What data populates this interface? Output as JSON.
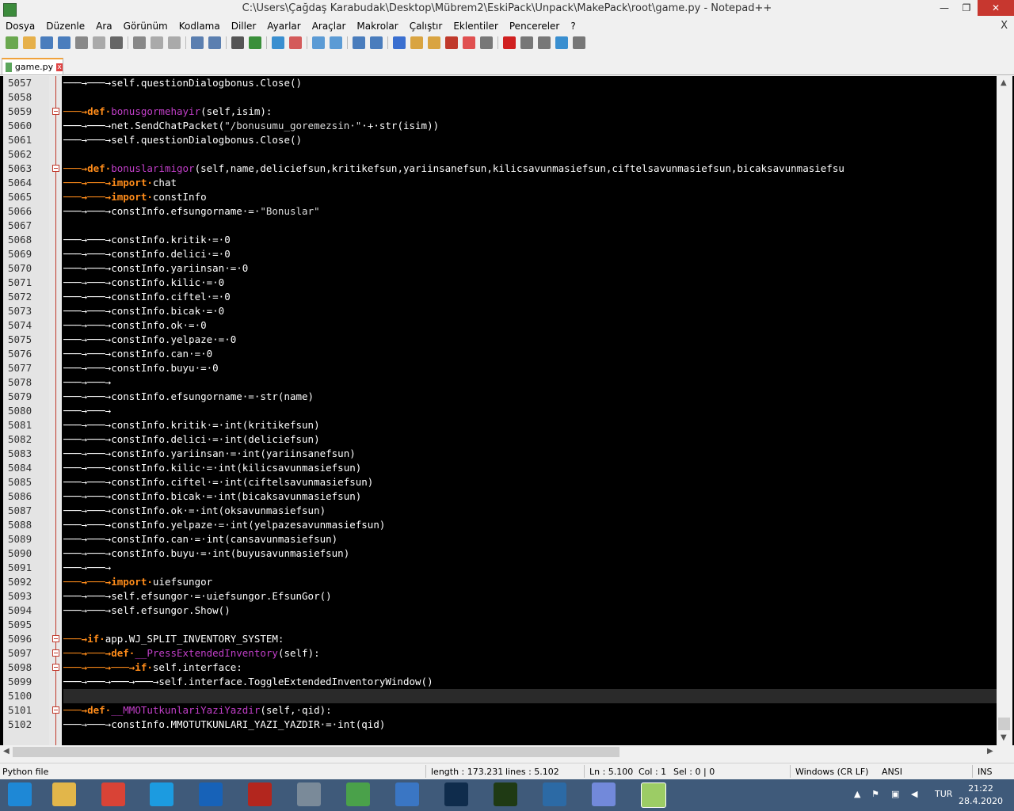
{
  "window": {
    "title": "C:\\Users\\Çağdaş Karabudak\\Desktop\\Mübrem2\\EskiPack\\Unpack\\MakePack\\root\\game.py - Notepad++",
    "min": "—",
    "max": "❐",
    "close": "✕"
  },
  "menu": [
    "Dosya",
    "Düzenle",
    "Ara",
    "Görünüm",
    "Kodlama",
    "Diller",
    "Ayarlar",
    "Araçlar",
    "Makrolar",
    "Çalıştır",
    "Eklentiler",
    "Pencereler",
    "?"
  ],
  "menu_close": "X",
  "tab": {
    "label": "game.py",
    "close": "x"
  },
  "status": {
    "filetype": "Python file",
    "length": "length : 173.231",
    "lines": "lines : 5.102",
    "ln": "Ln : 5.100",
    "col": "Col : 1",
    "sel": "Sel : 0 | 0",
    "eol": "Windows (CR LF)",
    "encoding": "ANSI",
    "mode": "INS"
  },
  "taskbar": {
    "lang": "TUR",
    "time": "21:22",
    "date": "28.4.2020"
  },
  "colors": {
    "keyword": "#ff8c1a",
    "function": "#c23fc9",
    "annotation": "#d8222a"
  },
  "code": [
    {
      "n": "5057",
      "tokens": [
        {
          "t": "\t\tself.questionDialogbonus.Close()",
          "c": "ty"
        }
      ]
    },
    {
      "n": "5058",
      "tokens": []
    },
    {
      "n": "5059",
      "fold": true,
      "tokens": [
        {
          "t": "\tdef ",
          "c": "kw"
        },
        {
          "t": "bonusgormehayir",
          "c": "fn"
        },
        {
          "t": "(self,isim):",
          "c": "ty"
        }
      ]
    },
    {
      "n": "5060",
      "tokens": [
        {
          "t": "\t\tnet.SendChatPacket(",
          "c": "ty"
        },
        {
          "t": "\"/bonusumu_goremezsin \"",
          "c": "st"
        },
        {
          "t": " + str(isim))",
          "c": "ty"
        }
      ]
    },
    {
      "n": "5061",
      "tokens": [
        {
          "t": "\t\tself.questionDialogbonus.Close()",
          "c": "ty"
        }
      ]
    },
    {
      "n": "5062",
      "tokens": []
    },
    {
      "n": "5063",
      "fold": true,
      "tokens": [
        {
          "t": "\tdef ",
          "c": "kw"
        },
        {
          "t": "bonuslarimigor",
          "c": "fn"
        },
        {
          "t": "(self,name,deliciefsun,kritikefsun,yariinsanefsun,kilicsavunmasiefsun,ciftelsavunmasiefsun,bicaksavunmasiefsu",
          "c": "ty"
        }
      ]
    },
    {
      "n": "5064",
      "tokens": [
        {
          "t": "\t\timport ",
          "c": "kw"
        },
        {
          "t": "chat",
          "c": "ty"
        }
      ]
    },
    {
      "n": "5065",
      "tokens": [
        {
          "t": "\t\timport ",
          "c": "kw"
        },
        {
          "t": "constInfo",
          "c": "ty"
        }
      ]
    },
    {
      "n": "5066",
      "tokens": [
        {
          "t": "\t\tconstInfo.efsungorname = ",
          "c": "ty"
        },
        {
          "t": "\"Bonuslar\"",
          "c": "st"
        }
      ]
    },
    {
      "n": "5067",
      "tokens": []
    },
    {
      "n": "5068",
      "tokens": [
        {
          "t": "\t\tconstInfo.kritik = 0",
          "c": "ty"
        }
      ]
    },
    {
      "n": "5069",
      "tokens": [
        {
          "t": "\t\tconstInfo.delici = 0",
          "c": "ty"
        }
      ]
    },
    {
      "n": "5070",
      "tokens": [
        {
          "t": "\t\tconstInfo.yariinsan = 0",
          "c": "ty"
        }
      ]
    },
    {
      "n": "5071",
      "tokens": [
        {
          "t": "\t\tconstInfo.kilic = 0",
          "c": "ty"
        }
      ]
    },
    {
      "n": "5072",
      "tokens": [
        {
          "t": "\t\tconstInfo.ciftel = 0",
          "c": "ty"
        }
      ]
    },
    {
      "n": "5073",
      "tokens": [
        {
          "t": "\t\tconstInfo.bicak = 0",
          "c": "ty"
        }
      ]
    },
    {
      "n": "5074",
      "tokens": [
        {
          "t": "\t\tconstInfo.ok = 0",
          "c": "ty"
        }
      ]
    },
    {
      "n": "5075",
      "tokens": [
        {
          "t": "\t\tconstInfo.yelpaze = 0",
          "c": "ty"
        }
      ]
    },
    {
      "n": "5076",
      "tokens": [
        {
          "t": "\t\tconstInfo.can = 0",
          "c": "ty"
        }
      ]
    },
    {
      "n": "5077",
      "tokens": [
        {
          "t": "\t\tconstInfo.buyu = 0",
          "c": "ty"
        }
      ]
    },
    {
      "n": "5078",
      "tokens": [
        {
          "t": "\t\t",
          "c": "ty"
        }
      ]
    },
    {
      "n": "5079",
      "tokens": [
        {
          "t": "\t\tconstInfo.efsungorname = str(name)",
          "c": "ty"
        }
      ]
    },
    {
      "n": "5080",
      "tokens": [
        {
          "t": "\t\t",
          "c": "ty"
        }
      ]
    },
    {
      "n": "5081",
      "tokens": [
        {
          "t": "\t\tconstInfo.kritik = int(kritikefsun)",
          "c": "ty"
        }
      ]
    },
    {
      "n": "5082",
      "tokens": [
        {
          "t": "\t\tconstInfo.delici = int(deliciefsun)",
          "c": "ty"
        }
      ]
    },
    {
      "n": "5083",
      "tokens": [
        {
          "t": "\t\tconstInfo.yariinsan = int(yariinsanefsun)",
          "c": "ty"
        }
      ]
    },
    {
      "n": "5084",
      "tokens": [
        {
          "t": "\t\tconstInfo.kilic = int(kilicsavunmasiefsun)",
          "c": "ty"
        }
      ]
    },
    {
      "n": "5085",
      "tokens": [
        {
          "t": "\t\tconstInfo.ciftel = int(ciftelsavunmasiefsun)",
          "c": "ty"
        }
      ]
    },
    {
      "n": "5086",
      "tokens": [
        {
          "t": "\t\tconstInfo.bicak = int(bicaksavunmasiefsun)",
          "c": "ty"
        }
      ]
    },
    {
      "n": "5087",
      "tokens": [
        {
          "t": "\t\tconstInfo.ok = int(oksavunmasiefsun)",
          "c": "ty"
        }
      ]
    },
    {
      "n": "5088",
      "tokens": [
        {
          "t": "\t\tconstInfo.yelpaze = int(yelpazesavunmasiefsun)",
          "c": "ty"
        }
      ]
    },
    {
      "n": "5089",
      "tokens": [
        {
          "t": "\t\tconstInfo.can = int(cansavunmasiefsun)",
          "c": "ty"
        }
      ]
    },
    {
      "n": "5090",
      "tokens": [
        {
          "t": "\t\tconstInfo.buyu = int(buyusavunmasiefsun)",
          "c": "ty"
        }
      ]
    },
    {
      "n": "5091",
      "tokens": [
        {
          "t": "\t\t",
          "c": "ty"
        }
      ]
    },
    {
      "n": "5092",
      "tokens": [
        {
          "t": "\t\timport ",
          "c": "kw"
        },
        {
          "t": "uiefsungor",
          "c": "ty"
        }
      ]
    },
    {
      "n": "5093",
      "tokens": [
        {
          "t": "\t\tself.efsungor = uiefsungor.EfsunGor()",
          "c": "ty"
        }
      ]
    },
    {
      "n": "5094",
      "tokens": [
        {
          "t": "\t\tself.efsungor.Show()",
          "c": "ty"
        }
      ]
    },
    {
      "n": "5095",
      "tokens": []
    },
    {
      "n": "5096",
      "fold": true,
      "tokens": [
        {
          "t": "\tif ",
          "c": "kw"
        },
        {
          "t": "app.WJ_SPLIT_INVENTORY_SYSTEM:",
          "c": "ty"
        }
      ]
    },
    {
      "n": "5097",
      "fold": true,
      "tokens": [
        {
          "t": "\t\tdef ",
          "c": "kw"
        },
        {
          "t": "__PressExtendedInventory",
          "c": "fn"
        },
        {
          "t": "(self):",
          "c": "ty"
        }
      ]
    },
    {
      "n": "5098",
      "fold": true,
      "tokens": [
        {
          "t": "\t\t\tif ",
          "c": "kw"
        },
        {
          "t": "self.interface:",
          "c": "ty"
        }
      ]
    },
    {
      "n": "5099",
      "tokens": [
        {
          "t": "\t\t\t\tself.interface.ToggleExtendedInventoryWindow()",
          "c": "ty"
        }
      ]
    },
    {
      "n": "5100",
      "caret": true,
      "tokens": []
    },
    {
      "n": "5101",
      "fold": true,
      "tokens": [
        {
          "t": "\tdef ",
          "c": "kw"
        },
        {
          "t": "__MMOTutkunlariYaziYazdir",
          "c": "fn"
        },
        {
          "t": "(self, qid):",
          "c": "ty"
        }
      ]
    },
    {
      "n": "5102",
      "tokens": [
        {
          "t": "\t\tconstInfo.MMOTUTKUNLARI_YAZI_YAZDIR = int(qid)",
          "c": "ty"
        }
      ]
    }
  ]
}
